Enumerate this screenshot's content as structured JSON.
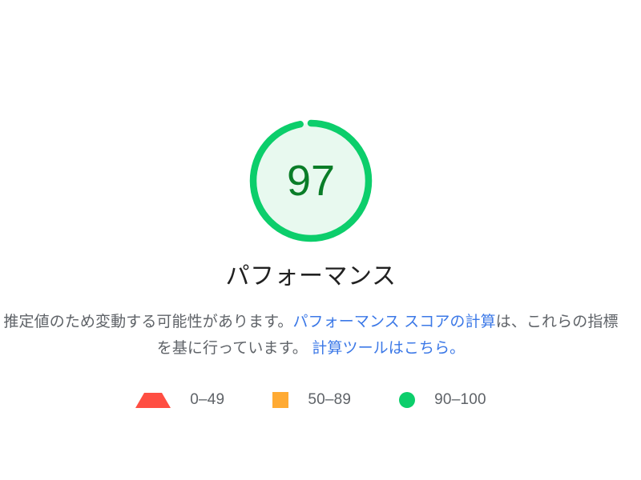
{
  "gauge": {
    "score": "97",
    "score_value": 97,
    "max": 100,
    "arc_color": "#0cce6b",
    "arc_background": "#e8f9ef",
    "score_color": "#0a7d28",
    "gap_percent": 3
  },
  "category": {
    "title": "パフォーマンス"
  },
  "description": {
    "line1_text": "推定値のため変動する可能性があります。",
    "line1_link": "パフォーマンス スコアの計算",
    "line2_text": "は、これらの指標を基に行っています。",
    "line2_link": "計算ツールはこちら。",
    "link_color": "#3b78e7",
    "text_color": "#5f6368"
  },
  "legend": {
    "items": [
      {
        "icon": "triangle-icon",
        "label": "0–49",
        "color": "#ff4e42"
      },
      {
        "icon": "square-icon",
        "label": "50–89",
        "color": "#ffaa33"
      },
      {
        "icon": "circle-icon",
        "label": "90–100",
        "color": "#0cce6b"
      }
    ]
  }
}
